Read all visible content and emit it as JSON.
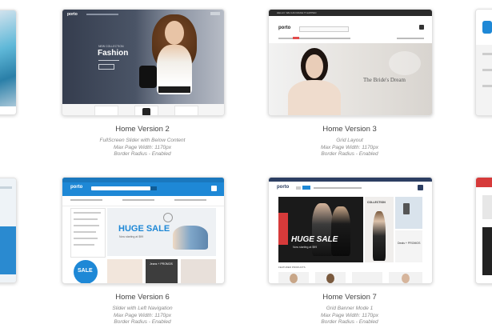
{
  "cards": [
    {
      "title": "Home Version 2",
      "lines": [
        "FullScreen Slider with Below Content",
        "Max Page Width: 1170px",
        "Border Radius - Enabled"
      ],
      "preview": {
        "logo": "porto",
        "eyebrow": "NEW COLLECTION",
        "headline": "Fashion",
        "cta": "SHOP NOW",
        "bg": "#3a4254"
      }
    },
    {
      "title": "Home Version 3",
      "lines": [
        "Grid Layout",
        "Max Page Width: 1170px",
        "Border Radius - Enabled"
      ],
      "preview": {
        "logo": "porto",
        "topbar": "HELLO. WE CAN MAKE IT HAPPEN",
        "headline": "The Bride's Dream",
        "accent": "#e24b4b"
      }
    },
    {
      "title": "Home Version 6",
      "lines": [
        "Slider with Left Navigation",
        "Max Page Width: 1170px",
        "Border Radius - Enabled"
      ],
      "preview": {
        "logo": "porto",
        "headline": "HUGE SALE",
        "sub": "Now starting at $99",
        "badge": "SALE",
        "banner": "Jeans + PROMOS",
        "accent": "#1e88d6"
      }
    },
    {
      "title": "Home Version 7",
      "lines": [
        "Grid Banner Mode 1",
        "Max Page Width: 1170px",
        "Border Radius - Enabled"
      ],
      "preview": {
        "logo": "porto",
        "headline": "HUGE SALE",
        "sub": "Now starting at $99",
        "collection": "COLLECTION",
        "promo": "Deals + PROMOS",
        "section": "FEATURED PRODUCTS",
        "accent": "#2c3e62"
      }
    }
  ]
}
